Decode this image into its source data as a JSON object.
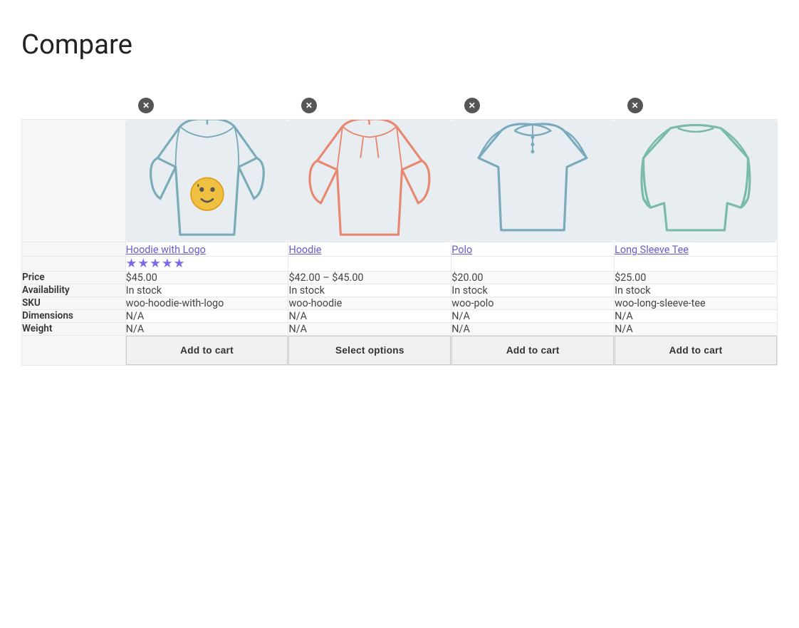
{
  "page": {
    "title": "Compare"
  },
  "products": [
    {
      "id": "hoodie-with-logo",
      "name": "Hoodie with Logo",
      "price": "$45.00",
      "availability": "In stock",
      "sku": "woo-hoodie-with-logo",
      "dimensions": "N/A",
      "weight": "N/A",
      "rating": 5,
      "action_label": "Add to cart",
      "action_type": "add",
      "image_type": "hoodie-logo"
    },
    {
      "id": "hoodie",
      "name": "Hoodie",
      "price": "$42.00 – $45.00",
      "availability": "In stock",
      "sku": "woo-hoodie",
      "dimensions": "N/A",
      "weight": "N/A",
      "rating": 0,
      "action_label": "Select options",
      "action_type": "options",
      "image_type": "hoodie"
    },
    {
      "id": "polo",
      "name": "Polo",
      "price": "$20.00",
      "availability": "In stock",
      "sku": "woo-polo",
      "dimensions": "N/A",
      "weight": "N/A",
      "rating": 0,
      "action_label": "Add to cart",
      "action_type": "add",
      "image_type": "polo"
    },
    {
      "id": "long-sleeve-tee",
      "name": "Long Sleeve Tee",
      "price": "$25.00",
      "availability": "In stock",
      "sku": "woo-long-sleeve-tee",
      "dimensions": "N/A",
      "weight": "N/A",
      "rating": 0,
      "action_label": "Add to cart",
      "action_type": "add",
      "image_type": "longsleeve"
    }
  ],
  "labels": {
    "price": "Price",
    "availability": "Availability",
    "sku": "SKU",
    "dimensions": "Dimensions",
    "weight": "Weight"
  }
}
